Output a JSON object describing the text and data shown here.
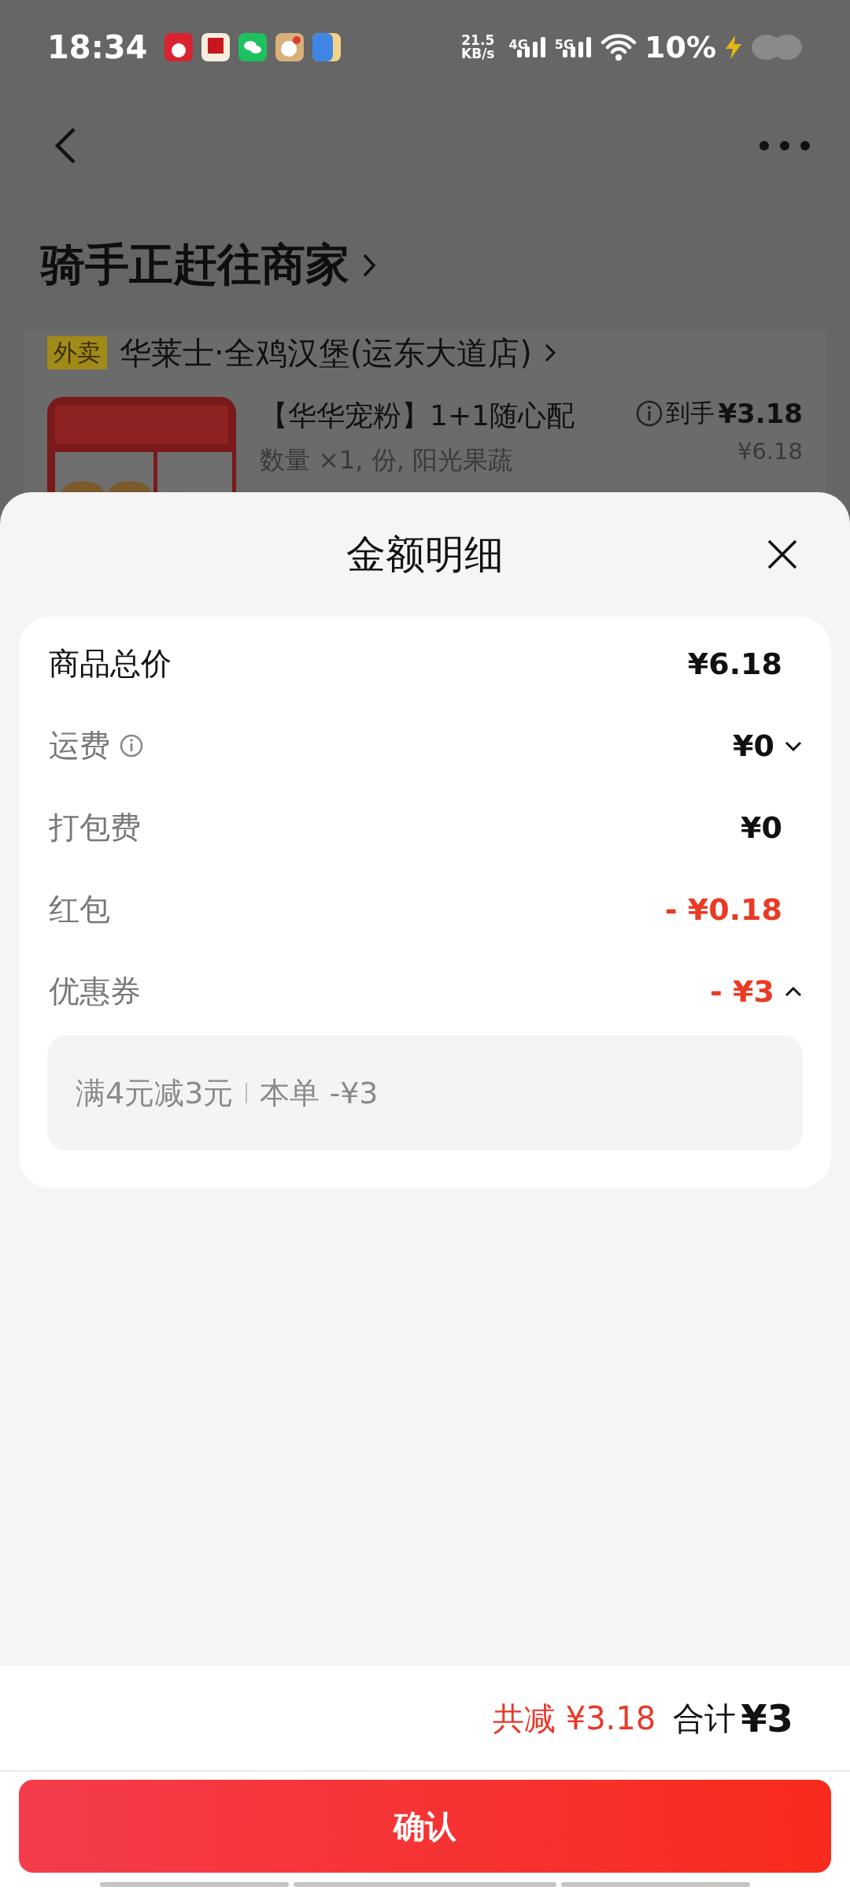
{
  "status_bar": {
    "time": "18:34",
    "speed_value": "21.5",
    "speed_unit": "KB/s",
    "networks": [
      "4G",
      "5G"
    ],
    "battery": "10%"
  },
  "header": {
    "title": "骑手正赶往商家"
  },
  "order": {
    "tag": "外卖",
    "store": "华莱士·全鸡汉堡(运东大道店)",
    "item": {
      "name": "【华华宠粉】1+1随心配",
      "spec": "数量 ×1, 份, 阳光果蔬",
      "price_label": "到手",
      "price": "¥3.18",
      "original_price": "¥6.18"
    }
  },
  "sheet": {
    "title": "金额明细",
    "rows": [
      {
        "label": "商品总价",
        "value": "¥6.18",
        "kind": "total",
        "info": false
      },
      {
        "label": "运费",
        "value": "¥0",
        "kind": "fee",
        "info": true,
        "expanded": false
      },
      {
        "label": "打包费",
        "value": "¥0",
        "kind": "fee",
        "info": false
      },
      {
        "label": "红包",
        "value": "- ¥0.18",
        "kind": "discount",
        "info": false
      },
      {
        "label": "优惠券",
        "value": "- ¥3",
        "kind": "discount",
        "info": false,
        "expanded": true,
        "detail": {
          "condition": "满4元减3元",
          "amount": "本单 -¥3"
        }
      }
    ]
  },
  "footer": {
    "saved": "共减 ¥3.18",
    "total_label": "合计",
    "total": "¥3",
    "button": "确认"
  }
}
